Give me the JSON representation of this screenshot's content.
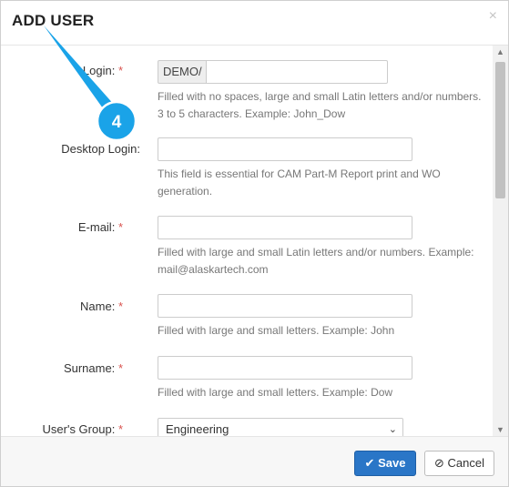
{
  "dialog": {
    "title": "ADD USER",
    "close_label": "×"
  },
  "callout": {
    "number": "4"
  },
  "scrollbar": {
    "up": "▲",
    "down": "▼"
  },
  "form": {
    "required_mark": "*",
    "login": {
      "label": "Login:",
      "prefix": "DEMO/",
      "value": "",
      "help": "Filled with no spaces, large and small Latin letters and/or numbers. 3 to 5 characters. Example: John_Dow"
    },
    "desktop_login": {
      "label": "Desktop Login:",
      "value": "",
      "help": "This field is essential for CAM Part-M Report print and WO generation."
    },
    "email": {
      "label": "E-mail:",
      "value": "",
      "help": "Filled with large and small Latin letters and/or numbers. Example: mail@alaskartech.com"
    },
    "name": {
      "label": "Name:",
      "value": "",
      "help": "Filled with large and small letters. Example: John"
    },
    "surname": {
      "label": "Surname:",
      "value": "",
      "help": "Filled with large and small letters. Example: Dow"
    },
    "users_group": {
      "label": "User's Group:",
      "selected": "Engineering",
      "arrow": "⌄"
    }
  },
  "footer": {
    "save_label": "Save",
    "save_icon": "✔",
    "cancel_label": "Cancel",
    "cancel_icon": "⊘"
  },
  "colors": {
    "primary": "#2a76c7",
    "required": "#d9534f",
    "callout": "#1aa3e8"
  }
}
